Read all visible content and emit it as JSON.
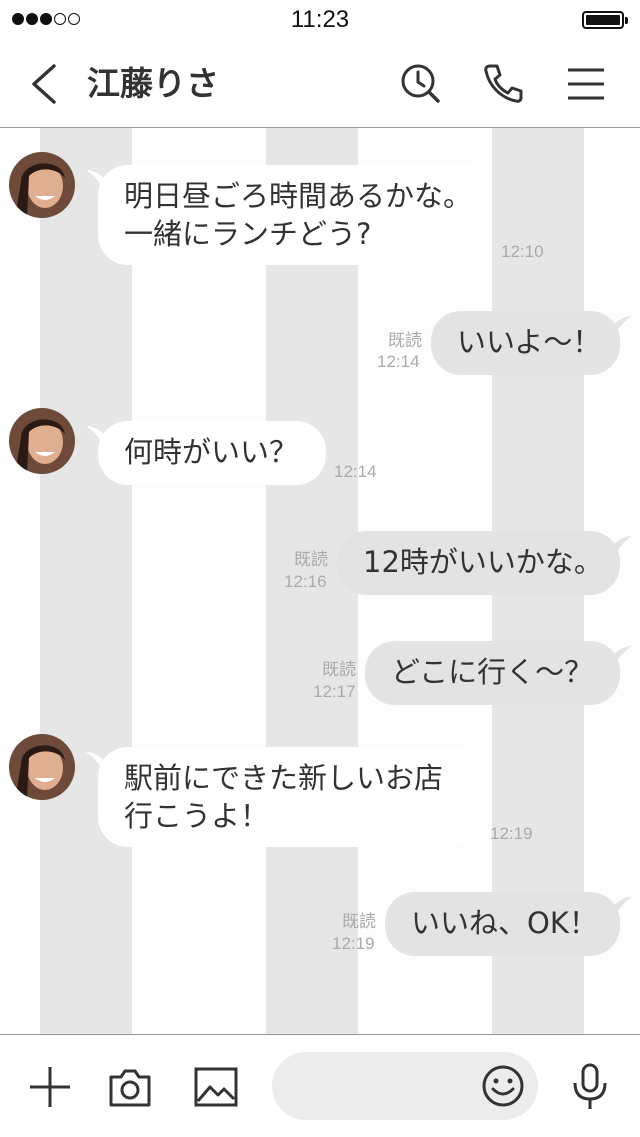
{
  "status_bar": {
    "time": "11:23",
    "signal_bars_filled": 3,
    "signal_bars_total": 5,
    "battery_level": 1.0
  },
  "header": {
    "title": "江藤りさ",
    "icons": [
      "back-chevron-icon",
      "clock-search-icon",
      "phone-icon",
      "menu-icon"
    ]
  },
  "messages": [
    {
      "direction": "in",
      "text": "明日昼ごろ時間あるかな。\n一緒にランチどう?",
      "time": "12:10"
    },
    {
      "direction": "out",
      "text": "いいよ～！",
      "read": "既読",
      "time": "12:14"
    },
    {
      "direction": "in",
      "text": "何時がいい？",
      "time": "12:14"
    },
    {
      "direction": "out",
      "text": "12時がいいかな。",
      "read": "既読",
      "time": "12:16"
    },
    {
      "direction": "out",
      "text": "どこに行く～？",
      "read": "既読",
      "time": "12:17"
    },
    {
      "direction": "in",
      "text": "駅前にできた新しいお店\n行こうよ！",
      "time": "12:19"
    },
    {
      "direction": "out",
      "text": "いいね、OK！",
      "read": "既読",
      "time": "12:19"
    }
  ],
  "bottom_bar": {
    "input_value": "",
    "icons": [
      "plus-icon",
      "camera-icon",
      "image-icon",
      "emoji-icon",
      "microphone-icon"
    ]
  },
  "colors": {
    "accent": "#333333",
    "outgoing_bubble": "#e3e3e3",
    "incoming_bubble": "#ffffff",
    "stripe": "#e6e6e6"
  }
}
